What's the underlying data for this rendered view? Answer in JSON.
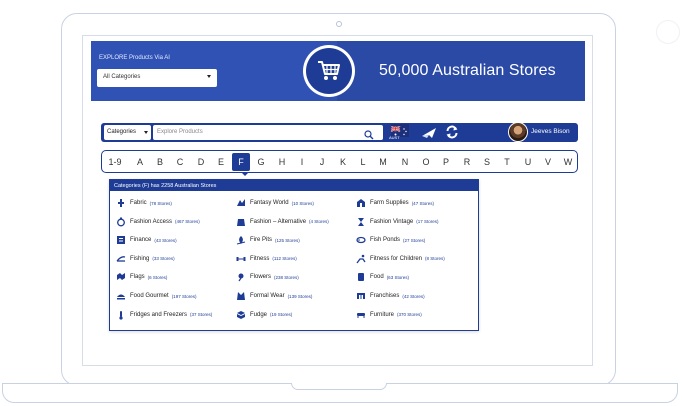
{
  "banner": {
    "explore_label": "EXPLORE Products Via AI",
    "category_select": "All Categories",
    "title": "50,000 Australian Stores",
    "cart_icon": "shopping-cart-icon"
  },
  "searchbar": {
    "category_label": "Categories",
    "placeholder": "Explore Products",
    "country_label": "AUST",
    "user_name": "Jeeves Bison"
  },
  "alphabet": {
    "items": [
      "1-9",
      "A",
      "B",
      "C",
      "D",
      "E",
      "F",
      "G",
      "H",
      "I",
      "J",
      "K",
      "L",
      "M",
      "N",
      "O",
      "P",
      "R",
      "S",
      "T",
      "U",
      "V",
      "W"
    ],
    "active": "F"
  },
  "panel": {
    "header": "Categories (F) has 2258 Australian Stores",
    "categories": [
      {
        "name": "Fabric",
        "count": "(78 Stores)",
        "icon": "fabric-icon"
      },
      {
        "name": "Fantasy World",
        "count": "(10 Stores)",
        "icon": "fantasy-icon"
      },
      {
        "name": "Farm Supplies",
        "count": "(47 Stores)",
        "icon": "farm-icon"
      },
      {
        "name": "Fashion Access",
        "count": "(467 Stores)",
        "icon": "accessory-icon"
      },
      {
        "name": "Fashion – Alternative",
        "count": "(4 Stores)",
        "icon": "alternative-icon"
      },
      {
        "name": "Fashion Vintage",
        "count": "(17 Stores)",
        "icon": "vintage-icon"
      },
      {
        "name": "Finance",
        "count": "(43 Stores)",
        "icon": "finance-icon"
      },
      {
        "name": "Fire Pits",
        "count": "(125 Stores)",
        "icon": "fire-icon"
      },
      {
        "name": "Fish Ponds",
        "count": "(27 Stores)",
        "icon": "fish-pond-icon"
      },
      {
        "name": "Fishing",
        "count": "(33 Stores)",
        "icon": "fishing-icon"
      },
      {
        "name": "Fitness",
        "count": "(112 Stores)",
        "icon": "dumbbell-icon"
      },
      {
        "name": "Fitness for Children",
        "count": "(8 Stores)",
        "icon": "child-fitness-icon"
      },
      {
        "name": "Flags",
        "count": "(6 Stores)",
        "icon": "flag-icon"
      },
      {
        "name": "Flowers",
        "count": "(238 Stores)",
        "icon": "flower-icon"
      },
      {
        "name": "Food",
        "count": "(63 Stores)",
        "icon": "food-icon"
      },
      {
        "name": "Food Gourmet",
        "count": "(197 Stores)",
        "icon": "gourmet-icon"
      },
      {
        "name": "Formal Wear",
        "count": "(139 Stores)",
        "icon": "formal-wear-icon"
      },
      {
        "name": "Franchises",
        "count": "(42 Stores)",
        "icon": "franchise-icon"
      },
      {
        "name": "Fridges and Freezers",
        "count": "(37 Stores)",
        "icon": "thermometer-icon"
      },
      {
        "name": "Fudge",
        "count": "(19 Stores)",
        "icon": "fudge-icon"
      },
      {
        "name": "Furniture",
        "count": "(370 Stores)",
        "icon": "furniture-icon"
      }
    ]
  },
  "colors": {
    "primary": "#1e3c96",
    "banner": "#2b4aa6",
    "frame": "#c9d2e3"
  }
}
